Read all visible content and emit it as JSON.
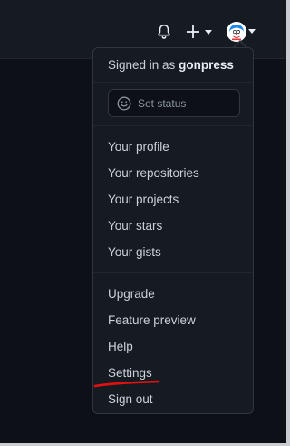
{
  "header": {
    "icons": {
      "notifications": "bell-icon",
      "create": "plus-icon",
      "user_menu": "avatar"
    }
  },
  "user_menu": {
    "signed_in_prefix": "Signed in as",
    "username": "gonpress",
    "status_placeholder": "Set status",
    "profile_section": [
      {
        "label": "Your profile"
      },
      {
        "label": "Your repositories"
      },
      {
        "label": "Your projects"
      },
      {
        "label": "Your stars"
      },
      {
        "label": "Your gists"
      }
    ],
    "account_section": [
      {
        "label": "Upgrade"
      },
      {
        "label": "Feature preview"
      },
      {
        "label": "Help"
      },
      {
        "label": "Settings"
      },
      {
        "label": "Sign out"
      }
    ]
  },
  "colors": {
    "header_bg": "#161b22",
    "page_bg": "#0d1117",
    "dropdown_bg": "#161b22",
    "border": "#30363d",
    "text": "#c9d1d9",
    "annotation_underline": "#e3100f"
  }
}
